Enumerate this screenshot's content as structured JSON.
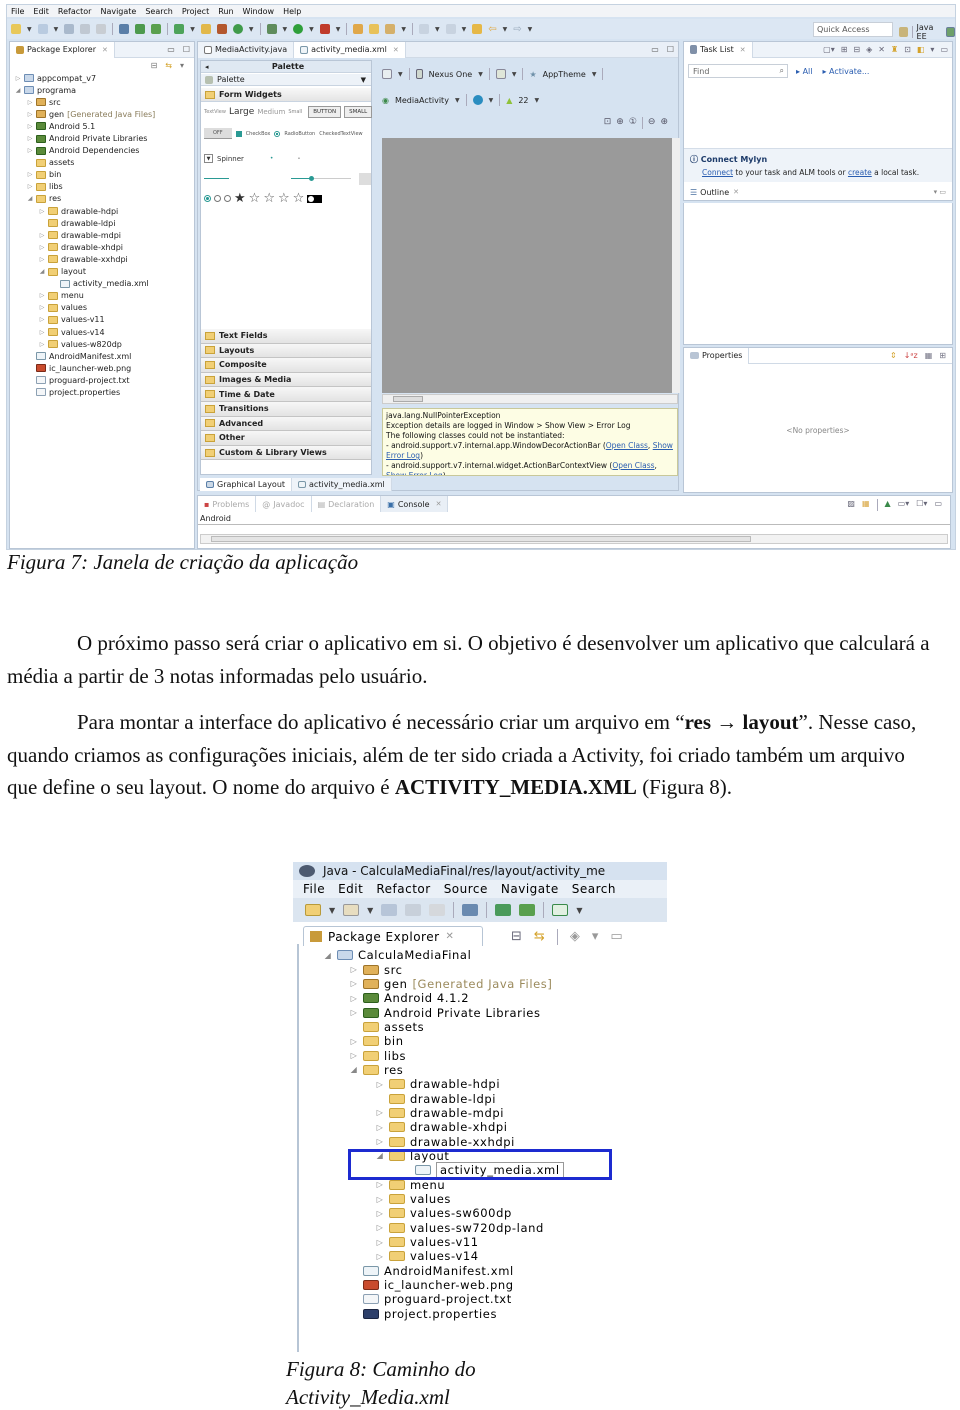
{
  "figure7": {
    "menubar": [
      "File",
      "Edit",
      "Refactor",
      "Navigate",
      "Search",
      "Project",
      "Run",
      "Window",
      "Help"
    ],
    "quick_access_placeholder": "Quick Access",
    "perspective": "Java EE",
    "package_explorer": {
      "tab": "Package Explorer",
      "tree": [
        {
          "indent": 0,
          "twisty": "▷",
          "icon": "proj",
          "label": "appcompat_v7"
        },
        {
          "indent": 0,
          "twisty": "◢",
          "icon": "proj",
          "label": "programa"
        },
        {
          "indent": 1,
          "twisty": "▷",
          "icon": "pkg",
          "label": "src"
        },
        {
          "indent": 1,
          "twisty": "▷",
          "icon": "pkg",
          "label": "gen",
          "suffix": "[Generated Java Files]"
        },
        {
          "indent": 1,
          "twisty": "▷",
          "icon": "lib",
          "label": "Android 5.1"
        },
        {
          "indent": 1,
          "twisty": "▷",
          "icon": "lib",
          "label": "Android Private Libraries"
        },
        {
          "indent": 1,
          "twisty": "▷",
          "icon": "lib",
          "label": "Android Dependencies"
        },
        {
          "indent": 1,
          "twisty": "",
          "icon": "folder",
          "label": "assets"
        },
        {
          "indent": 1,
          "twisty": "▷",
          "icon": "folder",
          "label": "bin"
        },
        {
          "indent": 1,
          "twisty": "▷",
          "icon": "folder",
          "label": "libs"
        },
        {
          "indent": 1,
          "twisty": "◢",
          "icon": "folder",
          "label": "res"
        },
        {
          "indent": 2,
          "twisty": "▷",
          "icon": "folder",
          "label": "drawable-hdpi"
        },
        {
          "indent": 2,
          "twisty": "",
          "icon": "folder",
          "label": "drawable-ldpi"
        },
        {
          "indent": 2,
          "twisty": "▷",
          "icon": "folder",
          "label": "drawable-mdpi"
        },
        {
          "indent": 2,
          "twisty": "▷",
          "icon": "folder",
          "label": "drawable-xhdpi"
        },
        {
          "indent": 2,
          "twisty": "▷",
          "icon": "folder",
          "label": "drawable-xxhdpi"
        },
        {
          "indent": 2,
          "twisty": "◢",
          "icon": "folder",
          "label": "layout"
        },
        {
          "indent": 3,
          "twisty": "",
          "icon": "xml",
          "label": "activity_media.xml"
        },
        {
          "indent": 2,
          "twisty": "▷",
          "icon": "folder",
          "label": "menu"
        },
        {
          "indent": 2,
          "twisty": "▷",
          "icon": "folder",
          "label": "values"
        },
        {
          "indent": 2,
          "twisty": "▷",
          "icon": "folder",
          "label": "values-v11"
        },
        {
          "indent": 2,
          "twisty": "▷",
          "icon": "folder",
          "label": "values-v14"
        },
        {
          "indent": 2,
          "twisty": "▷",
          "icon": "folder",
          "label": "values-w820dp"
        },
        {
          "indent": 1,
          "twisty": "",
          "icon": "xml",
          "label": "AndroidManifest.xml"
        },
        {
          "indent": 1,
          "twisty": "",
          "icon": "png",
          "label": "ic_launcher-web.png"
        },
        {
          "indent": 1,
          "twisty": "",
          "icon": "txt",
          "label": "proguard-project.txt"
        },
        {
          "indent": 1,
          "twisty": "",
          "icon": "txt",
          "label": "project.properties"
        }
      ]
    },
    "editor": {
      "tabs": [
        "MediaActivity.java",
        "activity_media.xml"
      ],
      "palette_title": "Palette",
      "palette_dropdown": "Palette",
      "form_widgets": "Form Widgets",
      "widgets_row1": [
        "TextView",
        "Large",
        "Medium",
        "Small",
        "BUTTON",
        "SMALL"
      ],
      "widgets_row2": [
        "OFF",
        "CheckBox",
        "RadioButton",
        "CheckedTextView"
      ],
      "spinner": "Spinner",
      "categories": [
        "Text Fields",
        "Layouts",
        "Composite",
        "Images & Media",
        "Time & Date",
        "Transitions",
        "Advanced",
        "Other",
        "Custom & Library Views"
      ],
      "device": "Nexus One",
      "theme": "AppTheme",
      "activity": "MediaActivity",
      "api_level": "22",
      "error_lines": [
        "java.lang.NullPointerException",
        "Exception details are logged in Window > Show View > Error Log",
        "The following classes could not be instantiated:",
        "- android.support.v7.internal.app.WindowDecorActionBar (",
        "- android.support.v7.internal.widget.ActionBarContextView ("
      ],
      "error_links": [
        "Open Class",
        "Show Error Log"
      ],
      "bottom_tabs": [
        "Graphical Layout",
        "activity_media.xml"
      ]
    },
    "console": {
      "tabs": [
        "Problems",
        "Javadoc",
        "Declaration",
        "Console"
      ],
      "label": "Android"
    },
    "task_list": {
      "tab": "Task List",
      "find_placeholder": "Find",
      "all": "All",
      "activate": "Activate...",
      "mylyn_title": "Connect Mylyn",
      "mylyn_connect": "Connect",
      "mylyn_mid": " to your task and ALM tools or ",
      "mylyn_create": "create",
      "mylyn_end": " a local task."
    },
    "outline": {
      "tab": "Outline"
    },
    "properties": {
      "tab": "Properties",
      "empty": "<No properties>"
    }
  },
  "caption7": "Figura 7: Janela de criação da aplicação",
  "paragraph1": "O próximo passo será criar o aplicativo em si. O objetivo é desenvolver um aplicativo que calculará a média a partir de 3 notas informadas pelo usuário.",
  "paragraph2": {
    "part1": "Para montar a interface do aplicativo é necessário criar um arquivo em “",
    "bold1": "res → layout",
    "part2": "”. Nesse caso, quando criamos as configurações iniciais, além de ter sido criada a Activity, foi criado também um arquivo que define o seu layout. O nome do arquivo é ",
    "bold2": "ACTIVITY_MEDIA.XML",
    "part3": " (Figura 8)."
  },
  "figure8": {
    "window_title": "Java - CalculaMediaFinal/res/layout/activity_me",
    "menubar": [
      "File",
      "Edit",
      "Refactor",
      "Source",
      "Navigate",
      "Search"
    ],
    "tab": "Package Explorer",
    "tree": [
      {
        "indent": 0,
        "twisty": "◢",
        "icon": "proj",
        "label": "CalculaMediaFinal"
      },
      {
        "indent": 1,
        "twisty": "▷",
        "icon": "pkg",
        "label": "src"
      },
      {
        "indent": 1,
        "twisty": "▷",
        "icon": "pkg",
        "label": "gen",
        "suffix": "[Generated Java Files]"
      },
      {
        "indent": 1,
        "twisty": "▷",
        "icon": "lib",
        "label": "Android 4.1.2"
      },
      {
        "indent": 1,
        "twisty": "▷",
        "icon": "lib",
        "label": "Android Private Libraries"
      },
      {
        "indent": 1,
        "twisty": "",
        "icon": "folder",
        "label": "assets"
      },
      {
        "indent": 1,
        "twisty": "▷",
        "icon": "folder",
        "label": "bin"
      },
      {
        "indent": 1,
        "twisty": "▷",
        "icon": "folder",
        "label": "libs"
      },
      {
        "indent": 1,
        "twisty": "◢",
        "icon": "folder",
        "label": "res"
      },
      {
        "indent": 2,
        "twisty": "▷",
        "icon": "folder",
        "label": "drawable-hdpi"
      },
      {
        "indent": 2,
        "twisty": "",
        "icon": "folder",
        "label": "drawable-ldpi"
      },
      {
        "indent": 2,
        "twisty": "▷",
        "icon": "folder",
        "label": "drawable-mdpi"
      },
      {
        "indent": 2,
        "twisty": "▷",
        "icon": "folder",
        "label": "drawable-xhdpi"
      },
      {
        "indent": 2,
        "twisty": "▷",
        "icon": "folder",
        "label": "drawable-xxhdpi"
      },
      {
        "indent": 2,
        "twisty": "◢",
        "icon": "folder",
        "label": "layout"
      },
      {
        "indent": 3,
        "twisty": "",
        "icon": "xml",
        "label": "activity_media.xml",
        "selected": true
      },
      {
        "indent": 2,
        "twisty": "▷",
        "icon": "folder",
        "label": "menu"
      },
      {
        "indent": 2,
        "twisty": "▷",
        "icon": "folder",
        "label": "values"
      },
      {
        "indent": 2,
        "twisty": "▷",
        "icon": "folder",
        "label": "values-sw600dp"
      },
      {
        "indent": 2,
        "twisty": "▷",
        "icon": "folder",
        "label": "values-sw720dp-land"
      },
      {
        "indent": 2,
        "twisty": "▷",
        "icon": "folder",
        "label": "values-v11"
      },
      {
        "indent": 2,
        "twisty": "▷",
        "icon": "folder",
        "label": "values-v14"
      },
      {
        "indent": 1,
        "twisty": "",
        "icon": "xml",
        "label": "AndroidManifest.xml"
      },
      {
        "indent": 1,
        "twisty": "",
        "icon": "png",
        "label": "ic_launcher-web.png"
      },
      {
        "indent": 1,
        "twisty": "",
        "icon": "txt",
        "label": "proguard-project.txt"
      },
      {
        "indent": 1,
        "twisty": "",
        "icon": "props",
        "label": "project.properties"
      }
    ],
    "highlight_color": "#1d2bd0"
  },
  "caption8_line1": "Figura 8: Caminho do",
  "caption8_line2": "Activity_Media.xml"
}
